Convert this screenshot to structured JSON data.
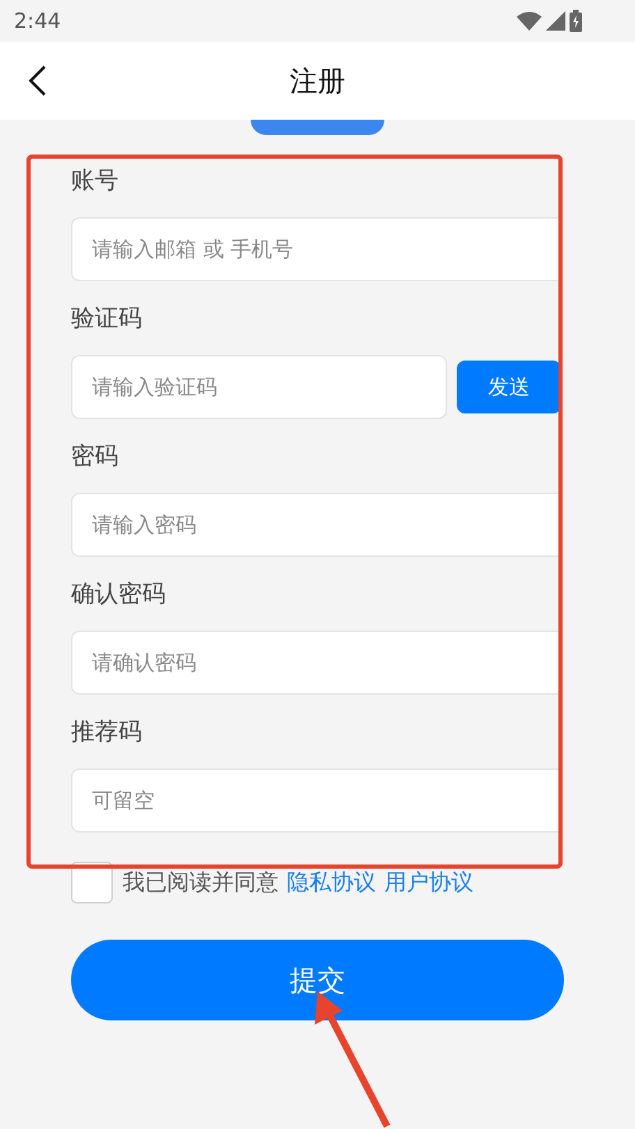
{
  "status_bar": {
    "time": "2:44"
  },
  "header": {
    "title": "注册"
  },
  "fields": [
    {
      "kind": "input",
      "label": "账号",
      "placeholder": "请输入邮箱 或 手机号"
    },
    {
      "kind": "code",
      "label": "验证码",
      "placeholder": "请输入验证码",
      "button": "发送"
    },
    {
      "kind": "input",
      "label": "密码",
      "placeholder": "请输入密码"
    },
    {
      "kind": "input",
      "label": "确认密码",
      "placeholder": "请确认密码"
    },
    {
      "kind": "input",
      "label": "推荐码",
      "placeholder": "可留空"
    }
  ],
  "agreement": {
    "checked": false,
    "text": "我已阅读并同意",
    "links": [
      "隐私协议",
      "用户协议"
    ]
  },
  "submit": "提交"
}
